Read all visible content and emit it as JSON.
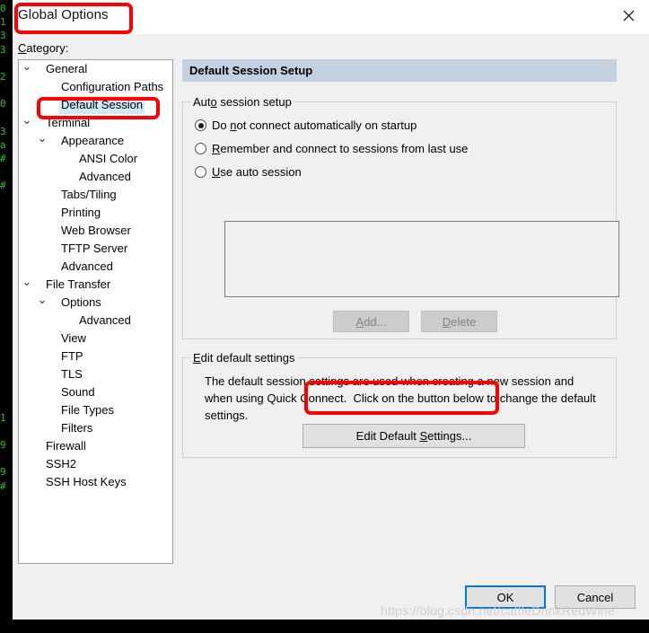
{
  "window": {
    "title": "Global Options",
    "close_icon": "close-icon"
  },
  "sidebar": {
    "label": "Category:",
    "label_accel": "C",
    "items": [
      {
        "label": "General",
        "indent": 0,
        "expander": "expanded",
        "selected": false
      },
      {
        "label": "Configuration Paths",
        "indent": 1,
        "expander": "none",
        "selected": false
      },
      {
        "label": "Default Session",
        "indent": 1,
        "expander": "none",
        "selected": true
      },
      {
        "label": "Terminal",
        "indent": 0,
        "expander": "expanded",
        "selected": false
      },
      {
        "label": "Appearance",
        "indent": 1,
        "expander": "expanded",
        "selected": false
      },
      {
        "label": "ANSI Color",
        "indent": 2,
        "expander": "none",
        "selected": false
      },
      {
        "label": "Advanced",
        "indent": 2,
        "expander": "none",
        "selected": false
      },
      {
        "label": "Tabs/Tiling",
        "indent": 1,
        "expander": "none",
        "selected": false
      },
      {
        "label": "Printing",
        "indent": 1,
        "expander": "none",
        "selected": false
      },
      {
        "label": "Web Browser",
        "indent": 1,
        "expander": "none",
        "selected": false
      },
      {
        "label": "TFTP Server",
        "indent": 1,
        "expander": "none",
        "selected": false
      },
      {
        "label": "Advanced",
        "indent": 1,
        "expander": "none",
        "selected": false
      },
      {
        "label": "File Transfer",
        "indent": 0,
        "expander": "expanded",
        "selected": false
      },
      {
        "label": "Options",
        "indent": 1,
        "expander": "expanded",
        "selected": false
      },
      {
        "label": "Advanced",
        "indent": 2,
        "expander": "none",
        "selected": false
      },
      {
        "label": "View",
        "indent": 1,
        "expander": "none",
        "selected": false
      },
      {
        "label": "FTP",
        "indent": 1,
        "expander": "none",
        "selected": false
      },
      {
        "label": "TLS",
        "indent": 1,
        "expander": "none",
        "selected": false
      },
      {
        "label": "Sound",
        "indent": 1,
        "expander": "none",
        "selected": false
      },
      {
        "label": "File Types",
        "indent": 1,
        "expander": "none",
        "selected": false
      },
      {
        "label": "Filters",
        "indent": 1,
        "expander": "none",
        "selected": false
      },
      {
        "label": "Firewall",
        "indent": 0,
        "expander": "none",
        "selected": false
      },
      {
        "label": "SSH2",
        "indent": 0,
        "expander": "none",
        "selected": false
      },
      {
        "label": "SSH Host Keys",
        "indent": 0,
        "expander": "none",
        "selected": false
      }
    ]
  },
  "content": {
    "header": "Default Session Setup",
    "auto_session": {
      "group_title_pre": "Aut",
      "group_title_accel": "o",
      "group_title_post": " session setup",
      "options": [
        {
          "pre": "Do ",
          "accel": "n",
          "post": "ot connect automatically on startup",
          "checked": true
        },
        {
          "pre": "",
          "accel": "R",
          "post": "emember and connect to sessions from last use",
          "checked": false
        },
        {
          "pre": "",
          "accel": "U",
          "post": "se auto session",
          "checked": false
        }
      ],
      "list_items": [],
      "add_button": {
        "pre": "",
        "accel": "A",
        "post": "dd...",
        "enabled": false
      },
      "delete_button": {
        "pre": "",
        "accel": "D",
        "post": "elete",
        "enabled": false
      }
    },
    "edit_defaults": {
      "group_title_pre": "",
      "group_title_accel": "E",
      "group_title_post": "dit default settings",
      "description": "The default session settings are used when creating a new session and when using Quick Connect.  Click on the button below to change the default settings.",
      "button": {
        "pre": "Edit Default ",
        "accel": "S",
        "post": "ettings...",
        "enabled": true
      }
    }
  },
  "footer": {
    "ok_label": "OK",
    "cancel_label": "Cancel"
  },
  "annotations": {
    "color": "#fb0000",
    "targets": [
      "window-title",
      "sidebar-item-default-session",
      "edit-default-settings-button"
    ]
  },
  "watermark": {
    "text": "https://blog.csdn.net/cattleDrinkRedWine"
  },
  "terminal_backdrop": {
    "bg_color": "#000000",
    "text_color": "#22c522",
    "lines": [
      "0 ",
      "1 ",
      "3 ",
      "3 ",
      "  ",
      "2 ",
      "  ",
      "0 ",
      "  ",
      "3 ",
      "a ",
      "# ",
      "  ",
      "# ",
      "  ",
      "  ",
      "  ",
      "  ",
      "  ",
      "  ",
      "  ",
      "  ",
      "  ",
      "  ",
      "  ",
      "  ",
      "  ",
      "  ",
      "  ",
      "  ",
      "1 ",
      "  ",
      "9 ",
      "  ",
      "9 ",
      "# ",
      "  ",
      "  ",
      "  ",
      "  ",
      "  ",
      "  ",
      "  ",
      "  ",
      "  ",
      "  "
    ]
  }
}
